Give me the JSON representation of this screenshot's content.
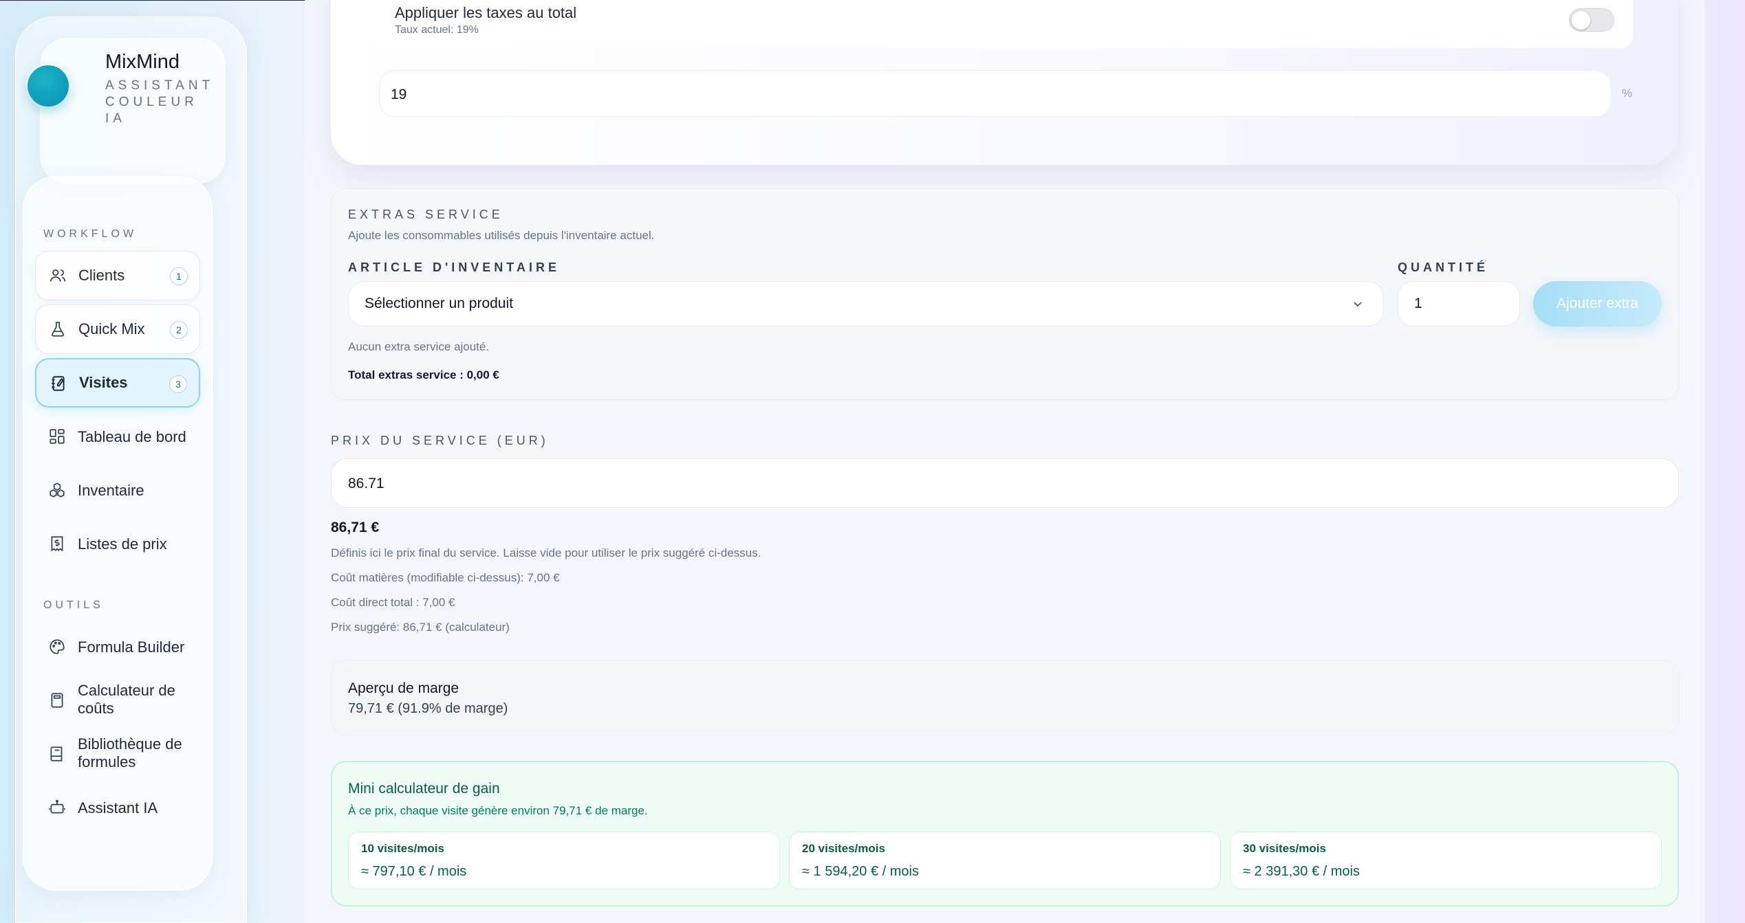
{
  "brand": {
    "name": "MixMind",
    "subtitle": "ASSISTANT COULEUR IA",
    "accent": "#0891b2"
  },
  "sidebar": {
    "workflow_label": "WORKFLOW",
    "tools_label": "OUTILS",
    "workflow_items": [
      {
        "label": "Clients",
        "badge": "1",
        "icon": "users-icon"
      },
      {
        "label": "Quick Mix",
        "badge": "2",
        "icon": "flask-icon"
      },
      {
        "label": "Visites",
        "badge": "3",
        "icon": "notebook-icon",
        "active": true
      },
      {
        "label": "Tableau de bord",
        "icon": "dashboard-icon"
      },
      {
        "label": "Inventaire",
        "icon": "boxes-icon"
      },
      {
        "label": "Listes de prix",
        "icon": "receipt-icon"
      }
    ],
    "tool_items": [
      {
        "label": "Formula Builder",
        "icon": "palette-icon"
      },
      {
        "label": "Calculateur de coûts",
        "icon": "calculator-icon"
      },
      {
        "label": "Bibliothèque de formules",
        "icon": "book-icon"
      },
      {
        "label": "Assistant IA",
        "icon": "bot-icon"
      }
    ]
  },
  "tax": {
    "title": "Appliquer les taxes au total",
    "current": "Taux actuel: 19%",
    "enabled": false,
    "value": "19",
    "unit": "%"
  },
  "extras": {
    "title": "EXTRAS SERVICE",
    "description": "Ajoute les consommables utilisés depuis l'inventaire actuel.",
    "article_label": "ARTICLE D'INVENTAIRE",
    "article_placeholder": "Sélectionner un produit",
    "quantity_label": "QUANTITÉ",
    "quantity_value": "1",
    "add_button": "Ajouter extra",
    "empty_text": "Aucun extra service ajouté.",
    "total_text": "Total extras service : 0,00 €"
  },
  "price": {
    "label": "PRIX DU SERVICE (EUR)",
    "input_value": "86.71",
    "formatted": "86,71 €",
    "help": "Définis ici le prix final du service. Laisse vide pour utiliser le prix suggéré ci-dessus.",
    "material_cost": "Coût matières (modifiable ci-dessus): 7,00 €",
    "direct_cost": "Coût direct total : 7,00 €",
    "suggested": "Prix suggéré: 86,71 € (calculateur)"
  },
  "margin": {
    "title": "Aperçu de marge",
    "value": "79,71 € (91.9% de marge)"
  },
  "gain": {
    "title": "Mini calculateur de gain",
    "subtitle": "À ce prix, chaque visite génère environ 79,71 € de marge.",
    "scenarios": [
      {
        "label": "10 visites/mois",
        "value": "≈ 797,10 € / mois"
      },
      {
        "label": "20 visites/mois",
        "value": "≈ 1 594,20 € / mois"
      },
      {
        "label": "30 visites/mois",
        "value": "≈ 2 391,30 € / mois"
      }
    ]
  }
}
